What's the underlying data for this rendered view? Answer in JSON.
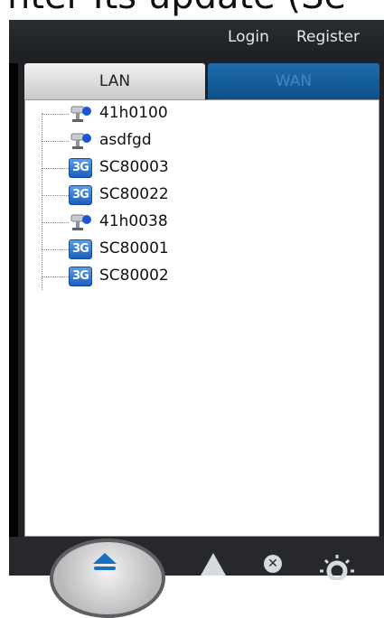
{
  "header": {
    "login_label": "Login",
    "register_label": "Register"
  },
  "tabs": [
    {
      "label": "LAN",
      "active": true
    },
    {
      "label": "WAN",
      "active": false
    }
  ],
  "devices": [
    {
      "name": "41h0100",
      "icon": "camera-icon"
    },
    {
      "name": "asdfgd",
      "icon": "camera-icon"
    },
    {
      "name": "SC80003",
      "icon": "3g-icon"
    },
    {
      "name": "SC80022",
      "icon": "3g-icon"
    },
    {
      "name": "41h0038",
      "icon": "camera-icon"
    },
    {
      "name": "SC80001",
      "icon": "3g-icon"
    },
    {
      "name": "SC80002",
      "icon": "3g-icon"
    }
  ],
  "icon_3g_text": "3G",
  "colors": {
    "app_bg": "#1f2124",
    "tab_active_bg": "#d9d9d9",
    "tab_inactive_bg": "#1565a6",
    "icon_3g_bg": "#2f78d6",
    "accent_blue": "#1a6fc0"
  }
}
